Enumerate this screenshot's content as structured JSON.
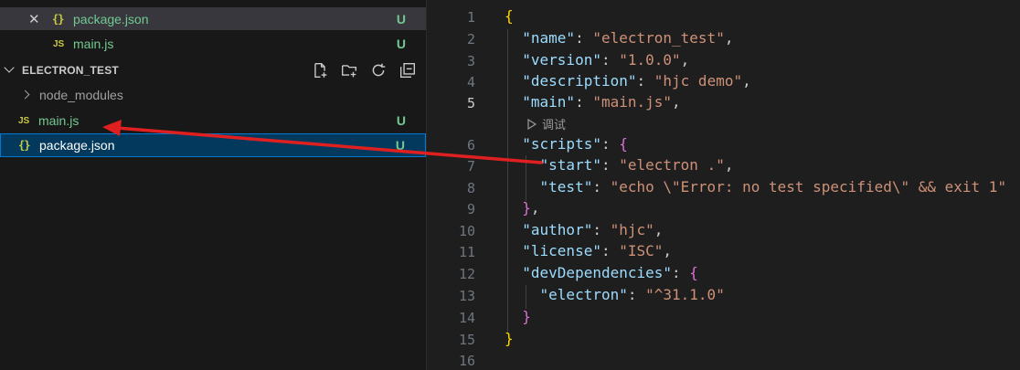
{
  "open_editors": [
    {
      "icon": "{}",
      "label": "package.json",
      "status": "U"
    },
    {
      "icon": "JS",
      "label": "main.js",
      "status": "U"
    }
  ],
  "explorer": {
    "section_title": "ELECTRON_TEST",
    "items": [
      {
        "icon": "",
        "label": "node_modules",
        "status": ""
      },
      {
        "icon": "JS",
        "label": "main.js",
        "status": "U"
      },
      {
        "icon": "{}",
        "label": "package.json",
        "status": "U"
      }
    ]
  },
  "editor": {
    "active_line": 5,
    "codelens_label": "调试",
    "lines": [
      {
        "n": "1"
      },
      {
        "n": "2"
      },
      {
        "n": "3"
      },
      {
        "n": "4"
      },
      {
        "n": "5"
      },
      {
        "n": "6"
      },
      {
        "n": "7"
      },
      {
        "n": "8"
      },
      {
        "n": "9"
      },
      {
        "n": "10"
      },
      {
        "n": "11"
      },
      {
        "n": "12"
      },
      {
        "n": "13"
      },
      {
        "n": "14"
      },
      {
        "n": "15"
      },
      {
        "n": "16"
      }
    ],
    "code": {
      "open_brace": "{",
      "name_key": "\"name\"",
      "name_val": "\"electron_test\"",
      "version_key": "\"version\"",
      "version_val": "\"1.0.0\"",
      "description_key": "\"description\"",
      "description_val": "\"hjc demo\"",
      "main_key": "\"main\"",
      "main_val": "\"main.js\"",
      "scripts_key": "\"scripts\"",
      "start_key": "\"start\"",
      "start_val": "\"electron .\"",
      "test_key": "\"test\"",
      "test_val": "\"echo \\\"Error: no test specified\\\" && exit 1\"",
      "scripts_close": "}",
      "author_key": "\"author\"",
      "author_val": "\"hjc\"",
      "license_key": "\"license\"",
      "license_val": "\"ISC\"",
      "devdeps_key": "\"devDependencies\"",
      "electron_key": "\"electron\"",
      "electron_val": "\"^31.1.0\"",
      "devdeps_close": "}",
      "close_brace": "}"
    }
  },
  "colors": {
    "annotation_arrow": "#e02020",
    "git_untracked": "#73c991",
    "selection_bg": "#04395e"
  }
}
